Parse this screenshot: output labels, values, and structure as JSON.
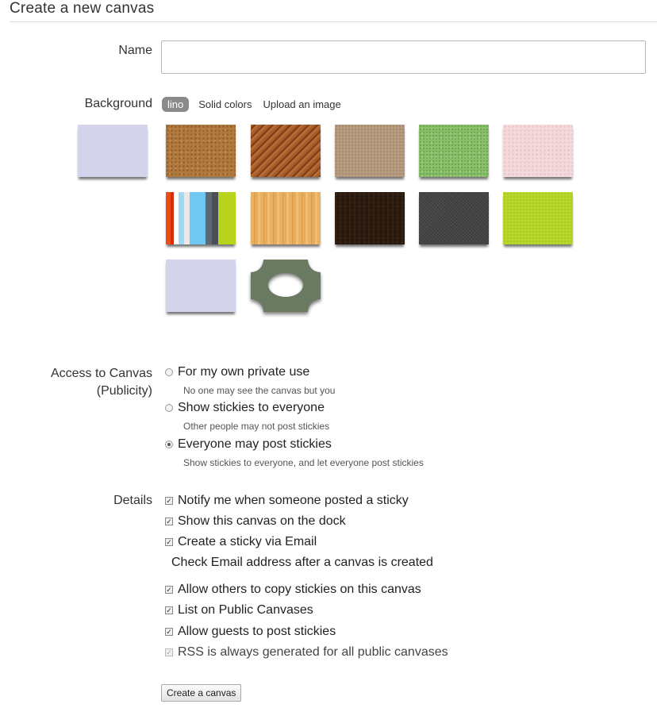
{
  "page": {
    "title": "Create a new canvas"
  },
  "name_field": {
    "label": "Name",
    "value": "",
    "placeholder": ""
  },
  "background": {
    "label": "Background",
    "tabs": [
      "lino",
      "Solid colors",
      "Upload an image"
    ],
    "active_tab": "lino",
    "preview_color": "#d3d4ec",
    "swatches": [
      {
        "name": "cork",
        "color": "#b07a3e"
      },
      {
        "name": "wood-diagonal",
        "color": "#9c5526"
      },
      {
        "name": "cardboard",
        "color": "#b89c80"
      },
      {
        "name": "green-felt",
        "color": "#8bbf6a"
      },
      {
        "name": "pink-paper",
        "color": "#f3d8dc"
      },
      {
        "name": "color-stripes",
        "color": "#6dc6ee"
      },
      {
        "name": "light-wood",
        "color": "#e2a95a"
      },
      {
        "name": "dark-wood",
        "color": "#2a1a0f"
      },
      {
        "name": "dark-fabric",
        "color": "#444444"
      },
      {
        "name": "lime",
        "color": "#b8d82c"
      },
      {
        "name": "lavender",
        "color": "#d3d4ec"
      },
      {
        "name": "gray-green-pattern",
        "color": "#6b7a62"
      }
    ]
  },
  "access": {
    "label_line1": "Access to Canvas",
    "label_line2": "(Publicity)",
    "options": [
      {
        "label": "For my own private use",
        "desc": "No one may see the canvas but you",
        "selected": false
      },
      {
        "label": "Show stickies to everyone",
        "desc": "Other people may not post stickies",
        "selected": false
      },
      {
        "label": "Everyone may post stickies",
        "desc": "Show stickies to everyone, and let everyone post stickies",
        "selected": true
      }
    ]
  },
  "details": {
    "label": "Details",
    "options": [
      {
        "label": "Notify me when someone posted a sticky",
        "checked": true
      },
      {
        "label": "Show this canvas on the dock",
        "checked": true
      },
      {
        "label": "Create a sticky via Email",
        "checked": true
      },
      {
        "label": "Allow others to copy stickies on this canvas",
        "checked": true
      },
      {
        "label": "List on Public Canvases",
        "checked": true
      },
      {
        "label": "Allow guests to post stickies",
        "checked": true
      },
      {
        "label": "RSS is always generated for all public canvases",
        "checked": true,
        "disabled": true
      }
    ],
    "email_note": "Check Email address after a canvas is created"
  },
  "submit": {
    "label": "Create a canvas"
  }
}
